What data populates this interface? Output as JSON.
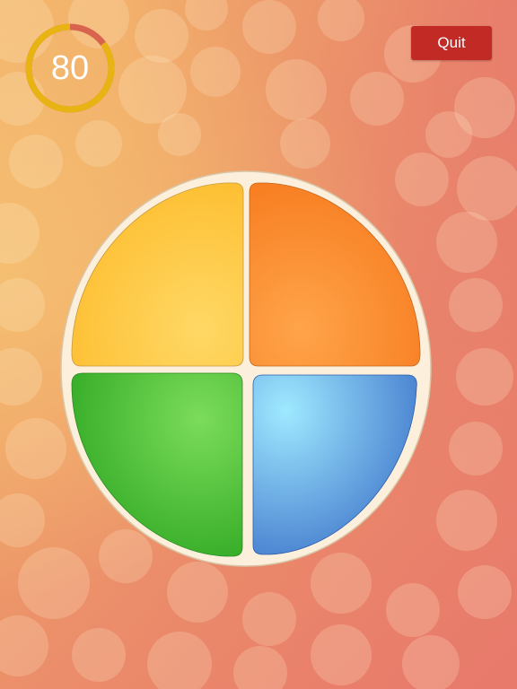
{
  "timer": {
    "value": "80",
    "ring_color": "#e8b414",
    "ring_remaining_color": "#d8644e",
    "progress_fraction": 0.85
  },
  "quit_button": {
    "label": "Quit",
    "color": "#c22a26"
  },
  "board": {
    "rim_color": "#fcefdc",
    "pads": [
      {
        "name": "yellow",
        "color": "#fec534"
      },
      {
        "name": "orange",
        "color": "#fc8a2a"
      },
      {
        "name": "green",
        "color": "#52c23c"
      },
      {
        "name": "blue",
        "color": "#66aeee"
      }
    ]
  },
  "background": {
    "top_left": "#f3b56c",
    "bottom_right": "#e97a6a"
  }
}
